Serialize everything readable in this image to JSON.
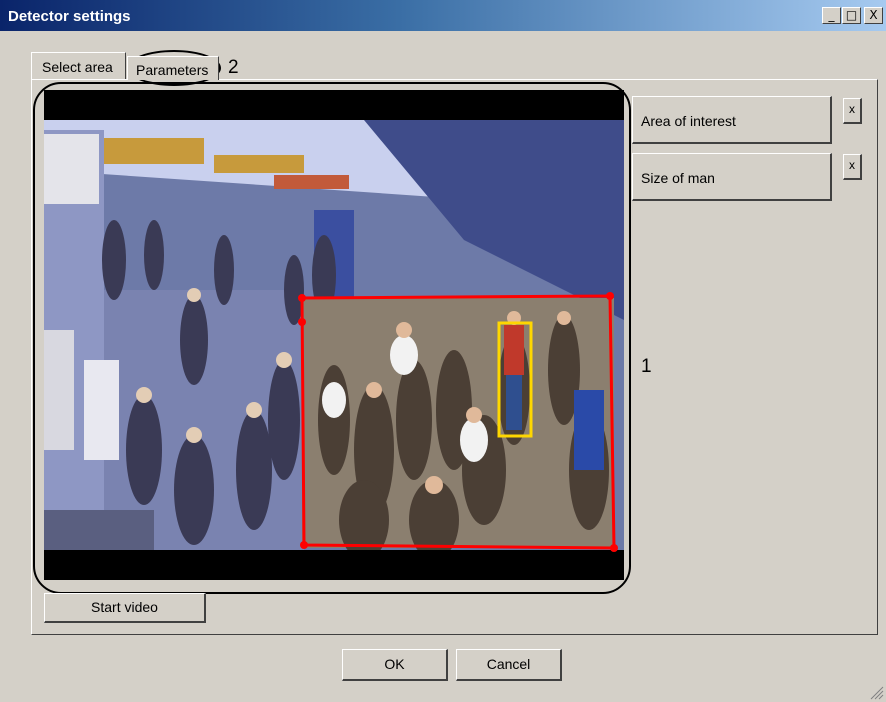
{
  "window": {
    "title": "Detector settings",
    "controls": {
      "minimize": "_",
      "maximize": "□",
      "close": "X"
    }
  },
  "tabs": [
    {
      "label": "Select area",
      "active": true
    },
    {
      "label": "Parameters",
      "active": false
    }
  ],
  "callouts": {
    "video_callout": "1",
    "tab_callout": "2"
  },
  "side_buttons": [
    {
      "label": "Area of interest",
      "clear_label": "x"
    },
    {
      "label": "Size of man",
      "clear_label": "x"
    }
  ],
  "actions": {
    "start_video": "Start video",
    "ok": "OK",
    "cancel": "Cancel"
  },
  "colors": {
    "area_of_interest": "#ff0000",
    "size_of_man": "#ffd700",
    "titlebar_start": "#0a246a",
    "titlebar_end": "#a6caf0"
  }
}
